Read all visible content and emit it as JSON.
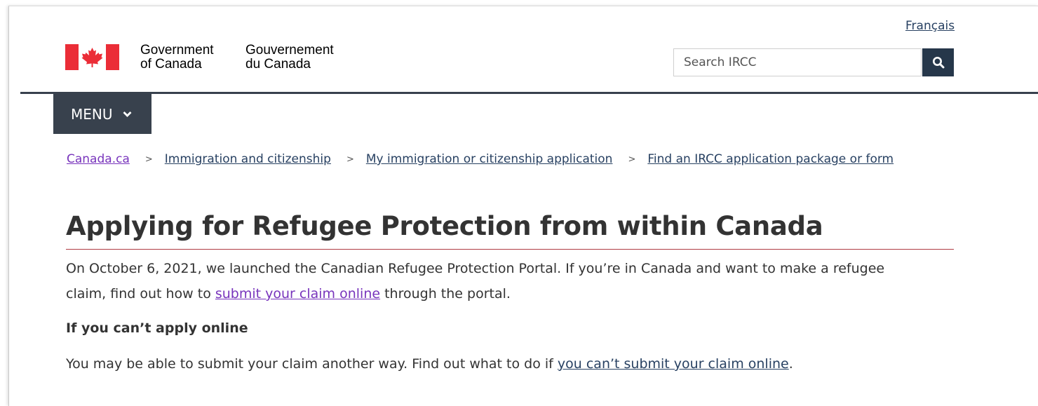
{
  "header": {
    "language_link": "Français",
    "wordmark_en_line1": "Government",
    "wordmark_en_line2": "of Canada",
    "wordmark_fr_line1": "Gouvernement",
    "wordmark_fr_line2": "du Canada",
    "search_placeholder": "Search IRCC",
    "search_icon": "search-icon",
    "flag_colors": {
      "red": "#eb2d37",
      "white": "#ffffff"
    }
  },
  "nav": {
    "menu_label": "MENU",
    "menu_icon": "chevron-down-icon"
  },
  "breadcrumb": {
    "items": [
      "Canada.ca",
      "Immigration and citizenship",
      "My immigration or citizenship application",
      "Find an IRCC application package or form"
    ],
    "separator": ">"
  },
  "main": {
    "title": "Applying for Refugee Protection from within Canada",
    "intro_before_link": "On October 6, 2021, we launched the Canadian Refugee Protection Portal. If you’re in Canada and want to make a refugee claim, find out how to ",
    "intro_link": "submit your claim online",
    "intro_after_link": " through the portal.",
    "subheading": "If you can’t apply online",
    "alt_before_link": "You may be able to submit your claim another way. Find out what to do if ",
    "alt_link": "you can’t submit your claim online",
    "alt_after_link": "."
  },
  "colors": {
    "link": "#284162",
    "visited_link": "#7834bc",
    "nav_bar": "#38414d",
    "search_button": "#26374a",
    "title_rule": "#af3c43"
  }
}
